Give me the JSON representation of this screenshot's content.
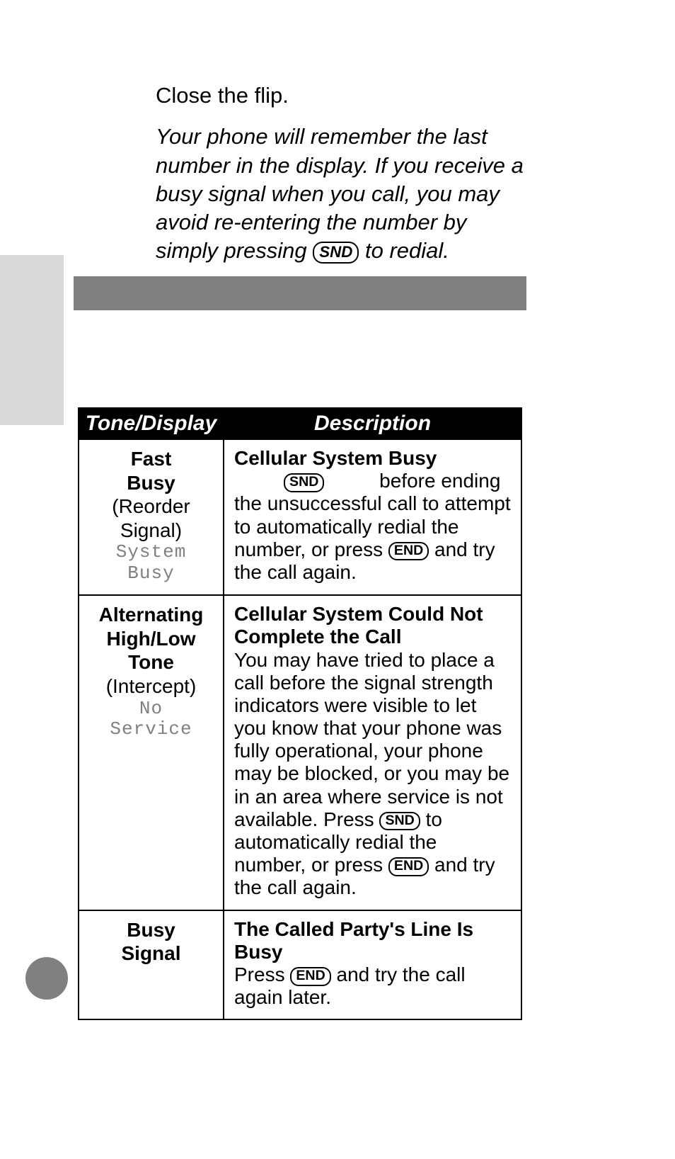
{
  "intro": {
    "line1": "Close the flip.",
    "note_part1": "Your phone will remember the last number in the display. If you receive a busy signal when you call, you may avoid re-entering the number by simply pressing ",
    "note_key": "SND",
    "note_part2": " to redial."
  },
  "table": {
    "headers": {
      "tone": "Tone/Display",
      "desc": "Description"
    },
    "rows": [
      {
        "tone_bold": "Fast\nBusy",
        "tone_paren": "(Reorder\nSignal)",
        "tone_lcd": "System\nBusy",
        "desc_title": "Cellular System Busy",
        "desc_pre": "",
        "desc_key1": "SND",
        "desc_mid1": " before ending the unsuccessful call to attempt to automatically redial the number, or press ",
        "desc_key2": "END",
        "desc_mid2": " and try the call again."
      },
      {
        "tone_bold": "Alternating\nHigh/Low\nTone",
        "tone_paren": "(Intercept)",
        "tone_lcd": "No\nService",
        "desc_title": "Cellular System Could Not Complete the Call",
        "desc_pre": "You may have tried to place a call before the signal strength indicators were visible to let you know that your phone was fully operational, your phone may be blocked, or you may be in an area where service is not available. Press ",
        "desc_key1": "SND",
        "desc_mid1": " to automatically redial the number, or press ",
        "desc_key2": "END",
        "desc_mid2": " and try the call again."
      },
      {
        "tone_bold": "Busy\nSignal",
        "tone_paren": "",
        "tone_lcd": "",
        "desc_title": "The Called Party's Line Is Busy",
        "desc_pre": "Press ",
        "desc_key1": "END",
        "desc_mid1": " and try the call again later.",
        "desc_key2": "",
        "desc_mid2": ""
      }
    ]
  }
}
